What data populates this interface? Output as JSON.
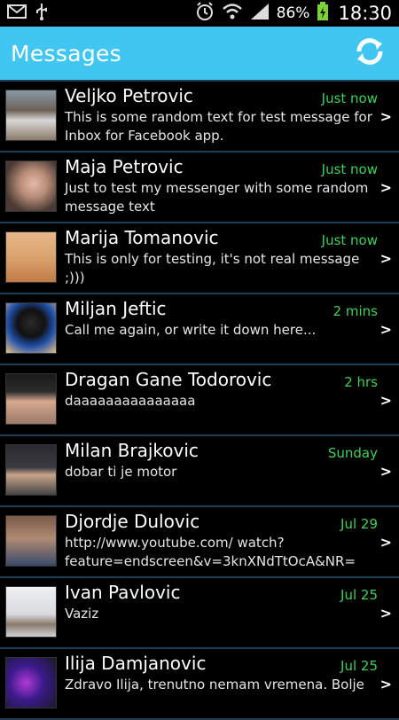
{
  "status": {
    "battery": "86%",
    "time": "18:30"
  },
  "header": {
    "title": "Messages"
  },
  "messages": [
    {
      "name": "Veljko Petrovic",
      "time": "Just now",
      "text": "This is some random text for test message for Inbox for Facebook app."
    },
    {
      "name": "Maja Petrovic",
      "time": "Just now",
      "text": "Just to test my messenger with some random message text"
    },
    {
      "name": "Marija Tomanovic",
      "time": "Just now",
      "text": "This is only for testing, it's not real message ;)))"
    },
    {
      "name": "Miljan Jeftic",
      "time": "2 mins",
      "text": "Call me again, or write it down here..."
    },
    {
      "name": "Dragan Gane Todorovic",
      "time": "2 hrs",
      "text": "daaaaaaaaaaaaaaa"
    },
    {
      "name": "Milan Brajkovic",
      "time": "Sunday",
      "text": "dobar ti je motor"
    },
    {
      "name": "Djordje Dulovic",
      "time": "Jul 29",
      "text": "http://www.youtube.com/ watch?feature=endscreen&v=3knXNdTtOcA&NR="
    },
    {
      "name": "Ivan Pavlovic",
      "time": "Jul 25",
      "text": "Vaziz"
    },
    {
      "name": "Ilija Damjanovic",
      "time": "Jul 25",
      "text": "Zdravo Ilija, trenutno nemam vremena. Bolje"
    }
  ],
  "colors": {
    "accent": "#40c6f0",
    "time": "#3fcf5a",
    "divider": "#1d3d55"
  },
  "icons": [
    "mail-icon",
    "usb-icon",
    "alarm-icon",
    "wifi-icon",
    "signal-icon",
    "battery-icon",
    "refresh-icon",
    "chevron-right-icon"
  ]
}
